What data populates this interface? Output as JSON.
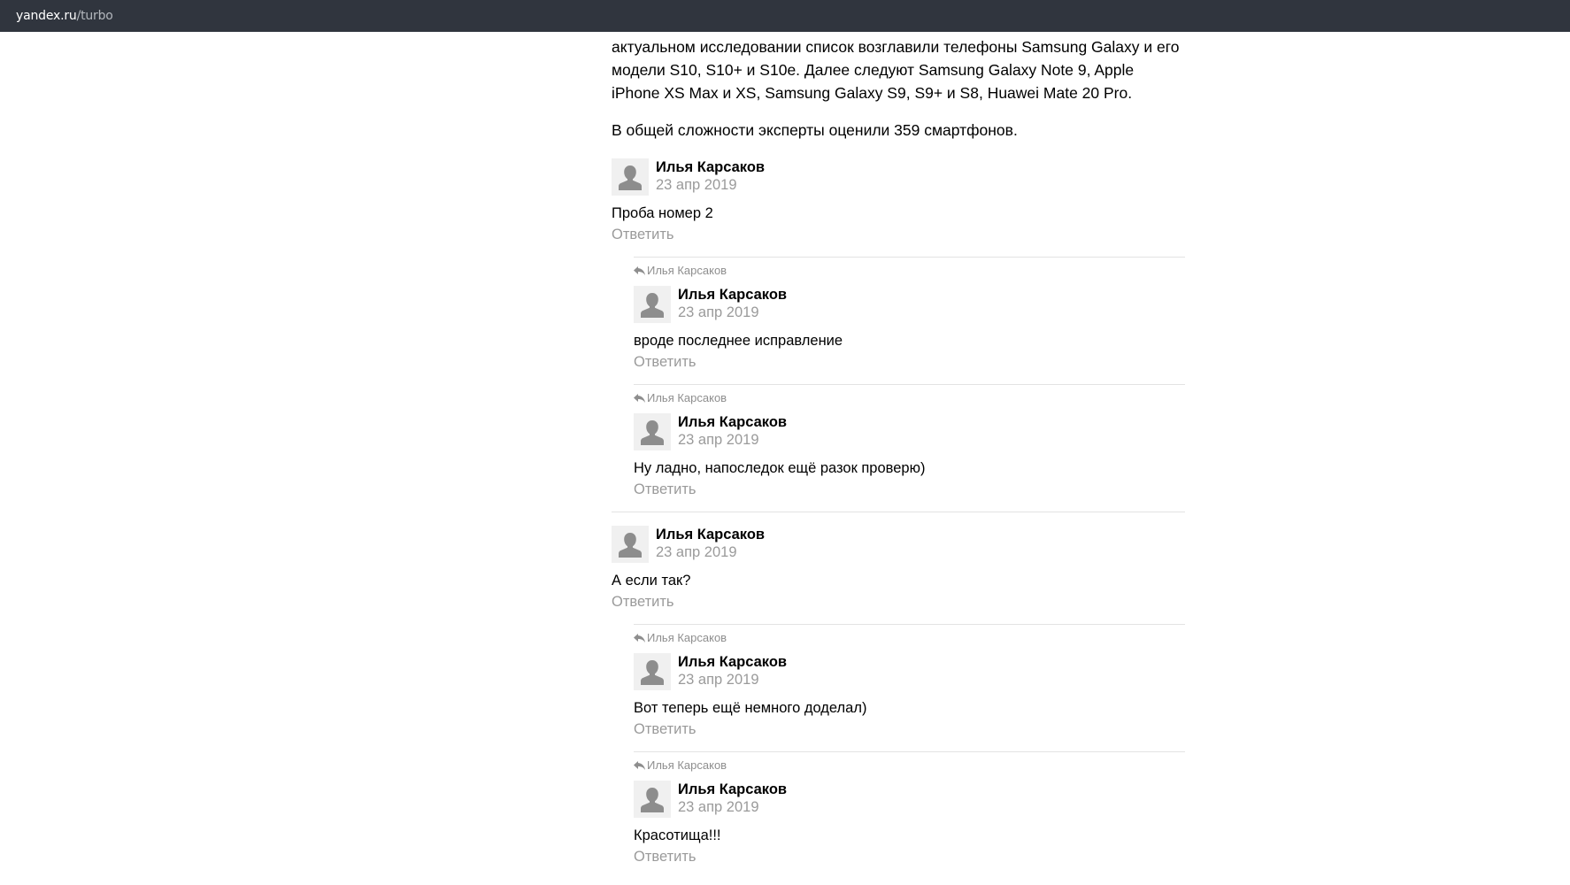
{
  "browser": {
    "url_domain": "yandex.ru",
    "url_path": "/turbo"
  },
  "article": {
    "paragraph_1": "актуальном исследовании список возглавили телефоны Samsung Galaxy и его модели S10, S10+ и S10e. Далее следуют Samsung Galaxy Note 9, Apple iPhone XS Max и XS, Samsung Galaxy S9, S9+ и S8, Huawei Mate 20 Pro.",
    "paragraph_2": "В общей сложности эксперты оценили 359 смартфонов."
  },
  "comments": [
    {
      "author": "Илья Карсаков",
      "date": "23 апр 2019",
      "text": "Проба номер 2",
      "reply_label": "Ответить",
      "replies": [
        {
          "reply_to": "Илья Карсаков",
          "author": "Илья Карсаков",
          "date": "23 апр 2019",
          "text": "вроде последнее исправление",
          "reply_label": "Ответить"
        },
        {
          "reply_to": "Илья Карсаков",
          "author": "Илья Карсаков",
          "date": "23 апр 2019",
          "text": "Ну ладно, напоследок ещё разок проверю)",
          "reply_label": "Ответить"
        }
      ]
    },
    {
      "author": "Илья Карсаков",
      "date": "23 апр 2019",
      "text": "А если так?",
      "reply_label": "Ответить",
      "replies": [
        {
          "reply_to": "Илья Карсаков",
          "author": "Илья Карсаков",
          "date": "23 апр 2019",
          "text": "Вот теперь ещё немного доделал)",
          "reply_label": "Ответить"
        },
        {
          "reply_to": "Илья Карсаков",
          "author": "Илья Карсаков",
          "date": "23 апр 2019",
          "text": "Красотища!!!",
          "reply_label": "Ответить"
        }
      ]
    }
  ],
  "icons": {
    "avatar": "default-user-avatar-icon",
    "reply_arrow": "reply-arrow-icon"
  },
  "colors": {
    "topbar_bg": "#30353e",
    "muted_text": "#9a9a9a",
    "separator": "#e3e3e3"
  }
}
